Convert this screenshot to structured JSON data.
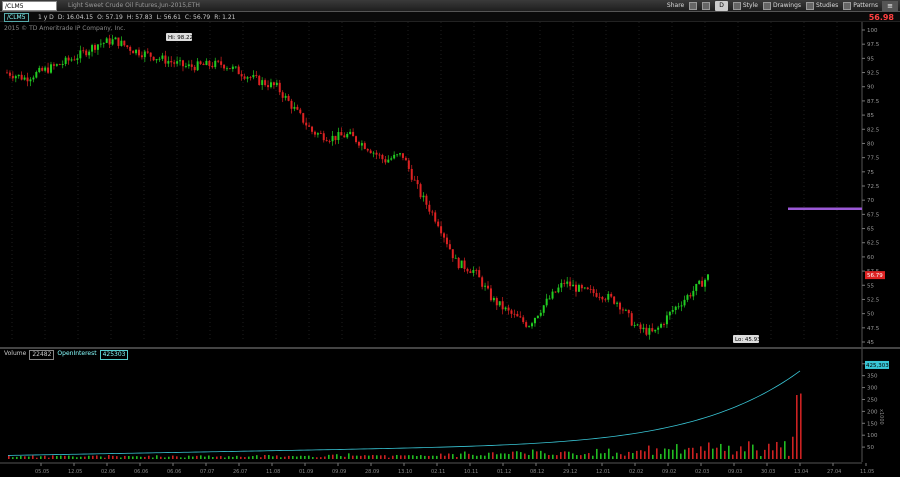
{
  "header": {
    "symbol": "/CLM5",
    "description": "Light Sweet Crude Oil Futures,Jun-2015,ETH",
    "toolbar": [
      "Share",
      "D",
      "Style",
      "Drawings",
      "Studies",
      "Patterns"
    ],
    "last_price": "56.98"
  },
  "status": {
    "symbol": "/CLM5",
    "aggregation": "1 y D",
    "date": "D: 16.04.15",
    "open": "O: 57.19",
    "high": "H: 57.83",
    "low": "L: 56.61",
    "close": "C: 56.79",
    "change": "R: 1.21"
  },
  "copyright": "2015 © TD Ameritrade IP Company, Inc.",
  "price_pane": {
    "y_ticks": [
      "100",
      "97.5",
      "95",
      "92.5",
      "90",
      "87.5",
      "85",
      "82.5",
      "80",
      "77.5",
      "75",
      "72.5",
      "70",
      "67.5",
      "65",
      "62.5",
      "60",
      "57.5",
      "55",
      "52.5",
      "50",
      "47.5",
      "45"
    ],
    "high_label": "Hi: 98.22",
    "low_label": "Lo: 45.93",
    "last_label": "56.79"
  },
  "volume_pane": {
    "volume_label": "Volume",
    "volume_value": "22482",
    "oi_label": "OpenInterest",
    "oi_value": "425303",
    "oi_tag": "425,303",
    "y_ticks": [
      "400",
      "350",
      "300",
      "250",
      "200",
      "150",
      "100",
      "50"
    ],
    "axis_title": "x1000"
  },
  "x_axis": [
    "05.05",
    "12.05",
    "02.06",
    "06.06",
    "06.06",
    "07.07",
    "26.07",
    "11.08",
    "01.09",
    "09.09",
    "28.09",
    "13.10",
    "02.11",
    "10.11",
    "01.12",
    "08.12",
    "29.12",
    "12.01",
    "02.02",
    "09.02",
    "02.03",
    "09.03",
    "30.03",
    "13.04",
    "27.04",
    "11.05"
  ],
  "chart_data": {
    "type": "candlestick",
    "title": "Light Sweet Crude Oil Futures,Jun-2015,ETH",
    "ylim": [
      45,
      100
    ],
    "high": 98.22,
    "low": 45.93,
    "last": 56.79,
    "trend": [
      92.5,
      91.5,
      92.8,
      94.0,
      95.5,
      97.5,
      98.2,
      96.5,
      95.5,
      94.5,
      93.5,
      93.8,
      94.0,
      92.5,
      91.0,
      90.0,
      86.0,
      82.0,
      81.0,
      81.5,
      79.5,
      77.0,
      78.0,
      71.0,
      66.0,
      59.0,
      57.5,
      52.5,
      50.0,
      48.0,
      52.0,
      55.5,
      54.0,
      53.5,
      52.0,
      47.5,
      46.5,
      50.5,
      53.5,
      56.5
    ],
    "resistance_level": 68.5
  }
}
